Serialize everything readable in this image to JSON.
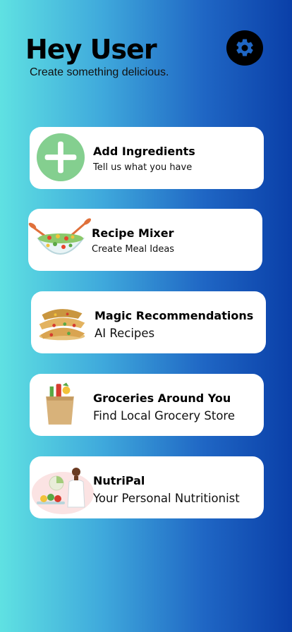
{
  "header": {
    "greeting": "Hey User",
    "subtitle": "Create something delicious."
  },
  "settings_icon": "gear-icon",
  "colors": {
    "gradient_start": "#5fe1e2",
    "gradient_end": "#0a3fa8",
    "add_circle": "#84cf8f",
    "card_bg": "#ffffff"
  },
  "cards": [
    {
      "title": "Add Ingredients",
      "description": "Tell us what you have",
      "icon": "plus-icon"
    },
    {
      "title": "Recipe Mixer",
      "description": "Create Meal Ideas",
      "icon": "salad-bowl-icon"
    },
    {
      "title": "Magic Recommendations",
      "description": "AI Recipes",
      "icon": "quesadilla-icon"
    },
    {
      "title": "Groceries Around You",
      "description": "Find Local Grocery Store",
      "icon": "grocery-bag-icon"
    },
    {
      "title": "NutriPal",
      "description": "Your Personal Nutritionist",
      "icon": "nutritionist-icon"
    }
  ]
}
